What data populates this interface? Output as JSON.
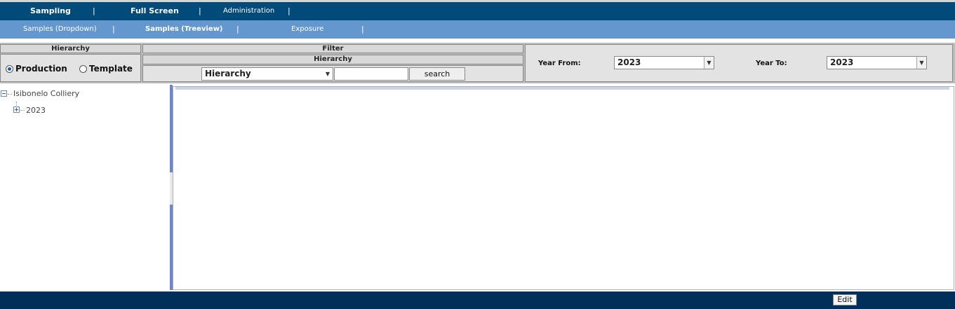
{
  "nav_primary": {
    "items": [
      {
        "label": "Sampling",
        "bold": true
      },
      {
        "label": "Full Screen",
        "bold": true
      },
      {
        "label": "Administration",
        "bold": false
      }
    ],
    "separator": "|"
  },
  "nav_secondary": {
    "items": [
      {
        "label": "Samples (Dropdown)",
        "bold": false
      },
      {
        "label": "Samples (Treeview)",
        "bold": true
      },
      {
        "label": "Exposure",
        "bold": false
      }
    ],
    "separator": "|"
  },
  "hierarchy_panel": {
    "header": "Hierarchy",
    "options": [
      {
        "label": "Production",
        "checked": true
      },
      {
        "label": "Template",
        "checked": false
      }
    ]
  },
  "filter_panel": {
    "header": "Filter",
    "subheader": "Hierarchy",
    "select_value": "Hierarchy",
    "search_value": "",
    "search_button": "search"
  },
  "year_panel": {
    "from_label": "Year From:",
    "from_value": "2023",
    "to_label": "Year To:",
    "to_value": "2023"
  },
  "tree": {
    "root": {
      "label": "Isibonelo Colliery",
      "expander": "−"
    },
    "child": {
      "label": "2023",
      "expander": "+"
    }
  },
  "footer": {
    "edit_button": "Edit"
  },
  "colors": {
    "nav_primary_bg": "#004b79",
    "nav_secondary_bg": "#6597cf",
    "footer_bg": "#00305a",
    "splitter": "#6e86c9"
  }
}
